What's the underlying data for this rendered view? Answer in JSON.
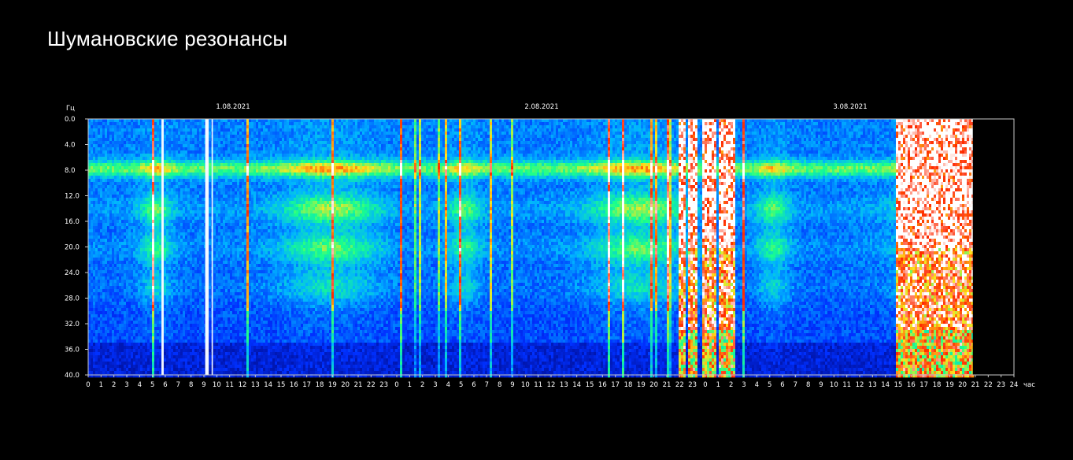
{
  "page": {
    "title": "Шумановские резонансы"
  },
  "chart_data": {
    "type": "heatmap",
    "title": "Шумановские резонансы",
    "ylabel": "Гц",
    "xlabel": "час",
    "ylim": [
      0,
      40
    ],
    "y_ticks": [
      "0.0",
      "4.0",
      "8.0",
      "12.0",
      "16.0",
      "20.0",
      "24.0",
      "28.0",
      "32.0",
      "36.0",
      "40.0"
    ],
    "x_ticks": [
      "0",
      "1",
      "2",
      "3",
      "4",
      "5",
      "6",
      "7",
      "8",
      "9",
      "10",
      "11",
      "12",
      "13",
      "14",
      "15",
      "16",
      "17",
      "18",
      "19",
      "20",
      "21",
      "22",
      "23",
      "0",
      "1",
      "2",
      "3",
      "4",
      "5",
      "6",
      "7",
      "8",
      "9",
      "10",
      "11",
      "12",
      "13",
      "14",
      "15",
      "16",
      "17",
      "18",
      "19",
      "20",
      "21",
      "22",
      "23",
      "0",
      "1",
      "2",
      "3",
      "4",
      "5",
      "6",
      "7",
      "8",
      "9",
      "10",
      "11",
      "12",
      "13",
      "14",
      "15",
      "16",
      "17",
      "18",
      "19",
      "20",
      "21",
      "22",
      "23",
      "24"
    ],
    "dates": [
      {
        "label": "1.08.2021",
        "hour": 12
      },
      {
        "label": "2.08.2021",
        "hour": 36
      },
      {
        "label": "3.08.2021",
        "hour": 60
      }
    ],
    "total_hours": 72,
    "data_end_hour": 68.8,
    "resonance_bands_hz": [
      7.8,
      14.1,
      20.3,
      26.4
    ],
    "high_activity_intervals_hours": [
      [
        45.9,
        46.3
      ],
      [
        46.6,
        47.3
      ],
      [
        47.6,
        48.7
      ],
      [
        49.0,
        50.2
      ],
      [
        62.8,
        65.4
      ],
      [
        65.4,
        66.6
      ],
      [
        66.6,
        68.7
      ]
    ],
    "color_scale": [
      "#000a8a",
      "#0030ff",
      "#00b4ff",
      "#19ff8c",
      "#ffe61e",
      "#ff2800",
      "#ffffff"
    ]
  }
}
